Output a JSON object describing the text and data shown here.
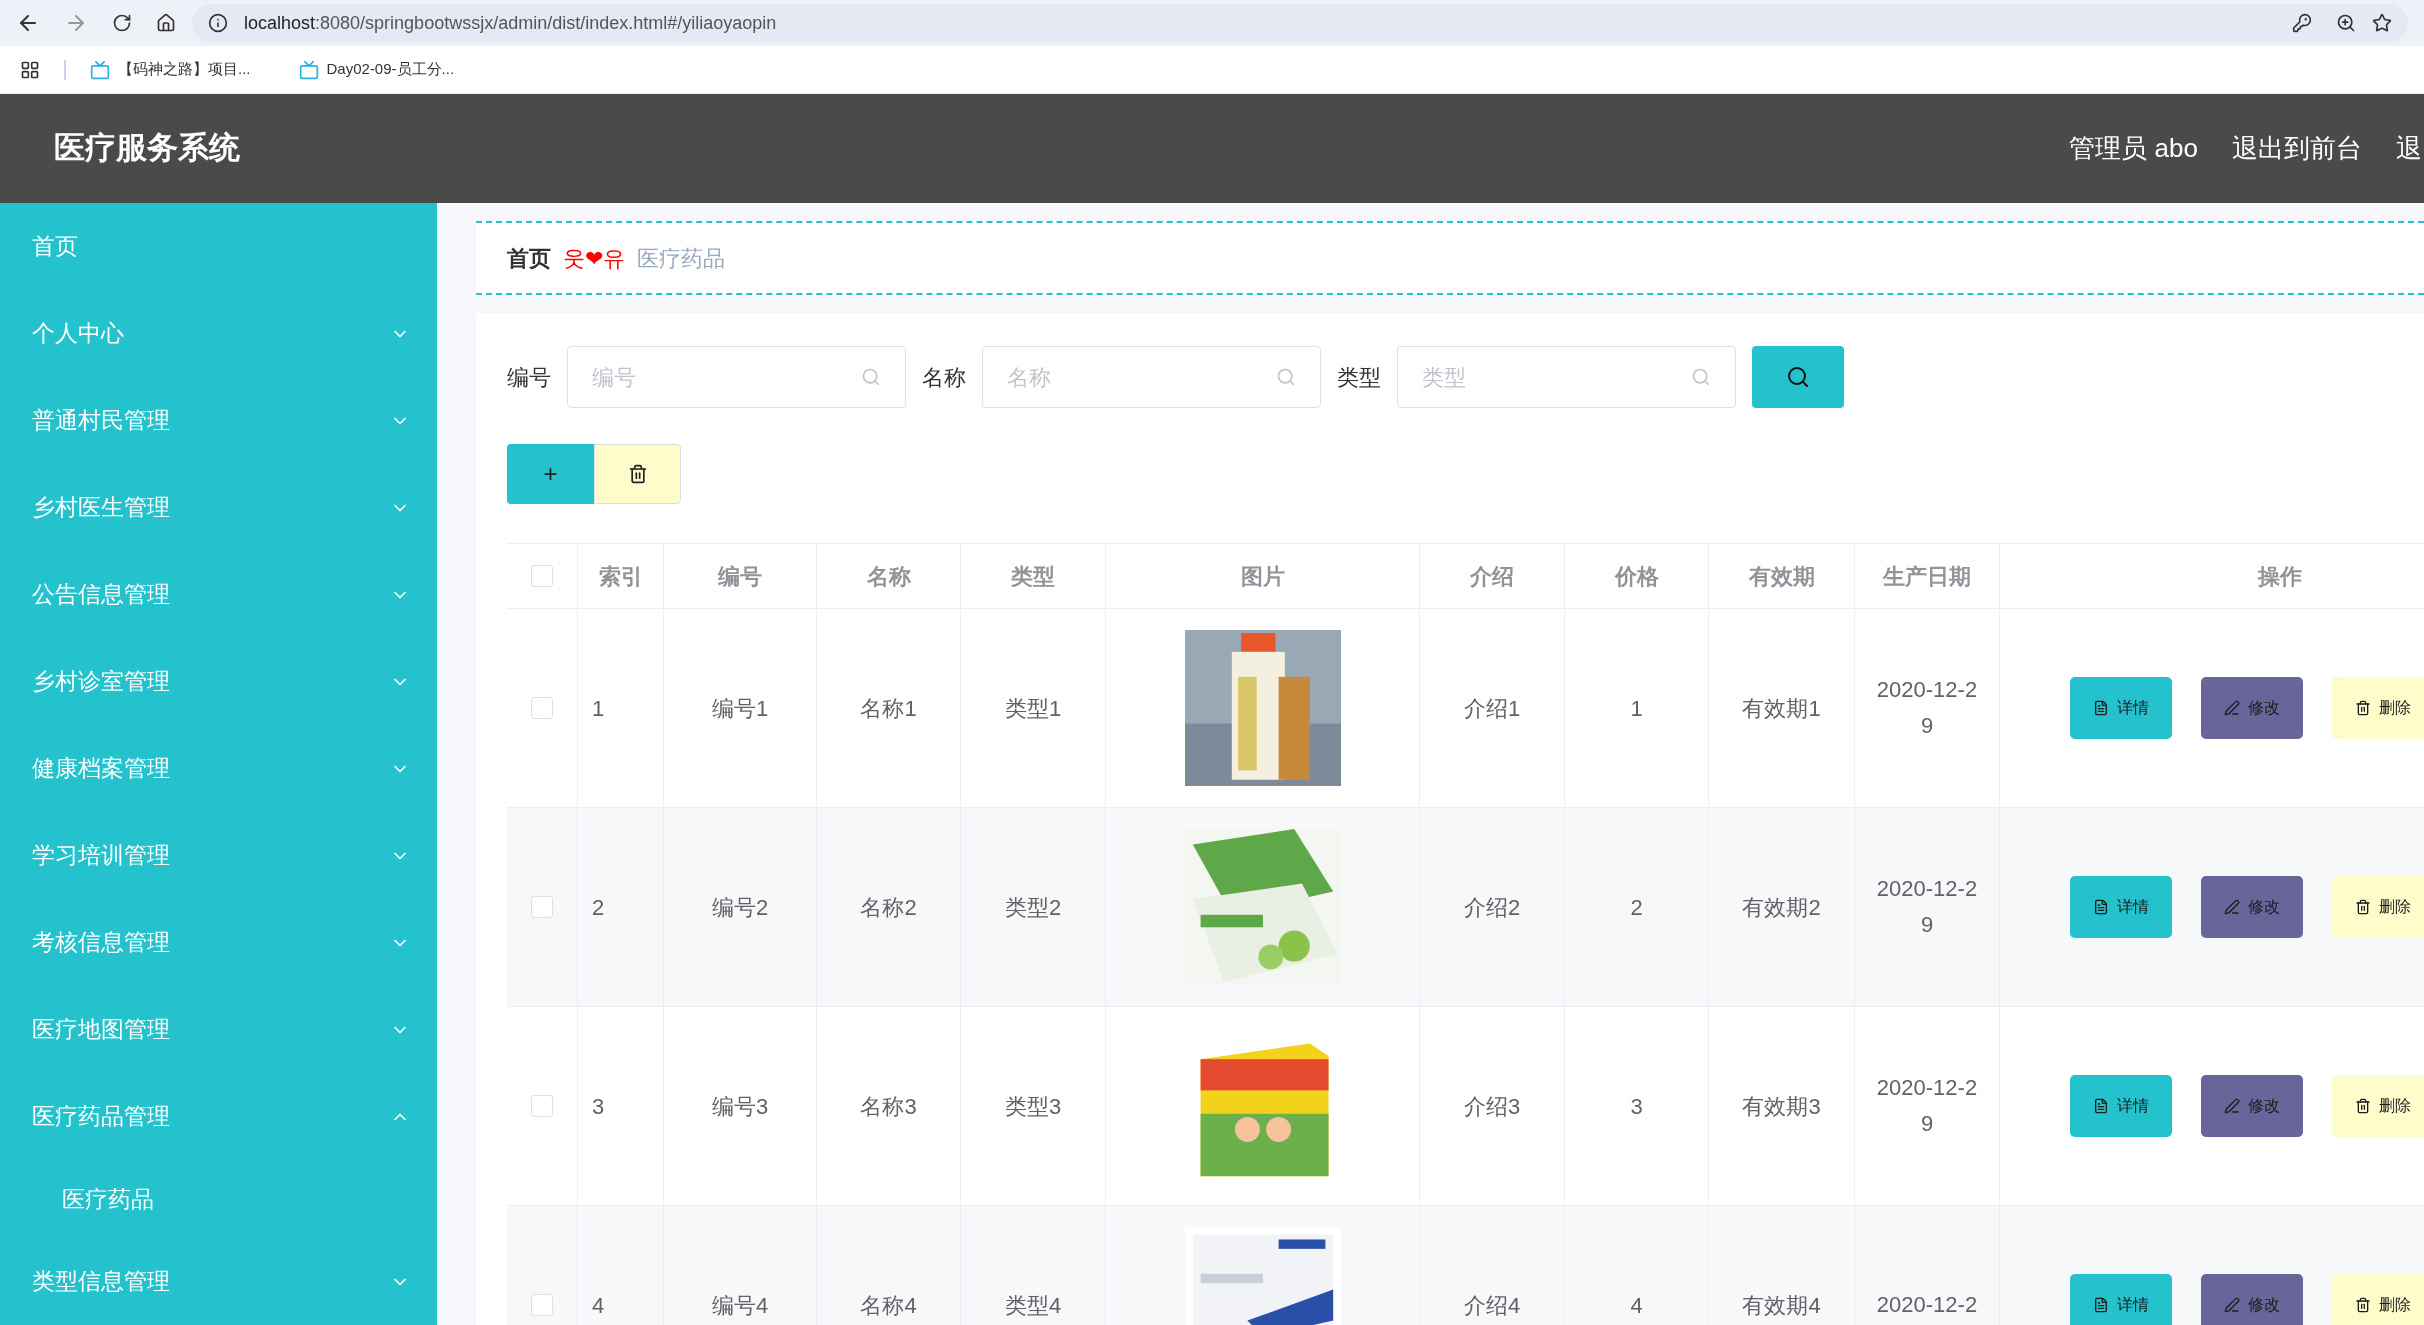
{
  "browser": {
    "url_host": "localhost",
    "url_rest": ":8080/springbootwssjx/admin/dist/index.html#/yiliaoyaopin",
    "bookmarks": [
      "【码神之路】项目...",
      "Day02-09-员工分..."
    ]
  },
  "header": {
    "title": "医疗服务系统",
    "links": [
      "管理员 abo",
      "退出到前台",
      "退"
    ]
  },
  "sidebar": {
    "items": [
      {
        "label": "首页"
      },
      {
        "label": "个人中心",
        "expanded": false
      },
      {
        "label": "普通村民管理",
        "expanded": false
      },
      {
        "label": "乡村医生管理",
        "expanded": false
      },
      {
        "label": "公告信息管理",
        "expanded": false
      },
      {
        "label": "乡村诊室管理",
        "expanded": false
      },
      {
        "label": "健康档案管理",
        "expanded": false
      },
      {
        "label": "学习培训管理",
        "expanded": false
      },
      {
        "label": "考核信息管理",
        "expanded": false
      },
      {
        "label": "医疗地图管理",
        "expanded": false
      },
      {
        "label": "医疗药品管理",
        "expanded": true,
        "children": [
          {
            "label": "医疗药品"
          }
        ]
      },
      {
        "label": "类型信息管理",
        "expanded": false
      }
    ]
  },
  "breadcrumb": {
    "home": "首页",
    "separator": "웃❤유",
    "current": "医疗药品"
  },
  "search": {
    "fields": [
      {
        "label": "编号",
        "placeholder": "编号"
      },
      {
        "label": "名称",
        "placeholder": "名称"
      },
      {
        "label": "类型",
        "placeholder": "类型"
      }
    ],
    "add_button": "+"
  },
  "table": {
    "header_checked": false,
    "columns": [
      "索引",
      "编号",
      "名称",
      "类型",
      "图片",
      "介绍",
      "价格",
      "有效期",
      "生产日期",
      "操作"
    ],
    "rows": [
      {
        "checked": false,
        "index": "1",
        "code": "编号1",
        "name": "名称1",
        "type": "类型1",
        "picture": {
          "kind": "picture"
        },
        "intro": "介绍1",
        "price": "1",
        "expiry": "有效期1",
        "date": "2020-12-29",
        "actions": [
          "详情",
          "修改",
          "删除"
        ]
      },
      {
        "checked": false,
        "index": "2",
        "code": "编号2",
        "name": "名称2",
        "type": "类型2",
        "picture": {
          "kind": "picture"
        },
        "intro": "介绍2",
        "price": "2",
        "expiry": "有效期2",
        "date": "2020-12-29",
        "actions": [
          "详情",
          "修改",
          "删除"
        ]
      },
      {
        "checked": false,
        "index": "3",
        "code": "编号3",
        "name": "名称3",
        "type": "类型3",
        "picture": {
          "kind": "picture"
        },
        "intro": "介绍3",
        "price": "3",
        "expiry": "有效期3",
        "date": "2020-12-29",
        "actions": [
          "详情",
          "修改",
          "删除"
        ]
      },
      {
        "checked": false,
        "index": "4",
        "code": "编号4",
        "name": "名称4",
        "type": "类型4",
        "picture": {
          "kind": "picture"
        },
        "intro": "介绍4",
        "price": "4",
        "expiry": "有效期4",
        "date": "2020-12-2",
        "actions": [
          "详情",
          "修改",
          "删除"
        ]
      }
    ]
  }
}
